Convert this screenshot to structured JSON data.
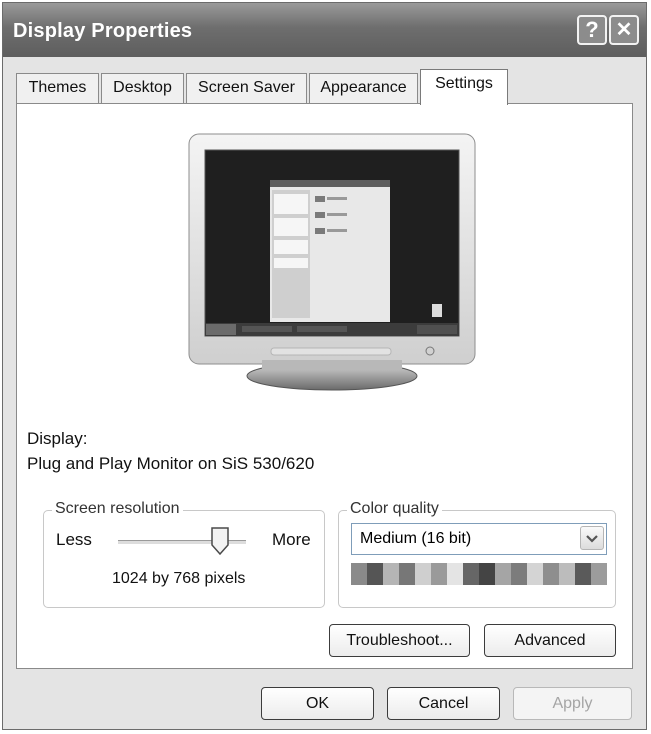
{
  "window": {
    "title": "Display Properties",
    "help_glyph": "?",
    "close_glyph": "✕"
  },
  "tabs": [
    {
      "label": "Themes"
    },
    {
      "label": "Desktop"
    },
    {
      "label": "Screen Saver"
    },
    {
      "label": "Appearance"
    },
    {
      "label": "Settings",
      "active": true
    }
  ],
  "display": {
    "label": "Display:",
    "device": "Plug and Play Monitor on SiS 530/620"
  },
  "resolution": {
    "group_label": "Screen resolution",
    "less": "Less",
    "more": "More",
    "value_text": "1024 by 768 pixels",
    "slider_position": 0.8
  },
  "color_quality": {
    "group_label": "Color quality",
    "selected": "Medium (16 bit)"
  },
  "buttons": {
    "troubleshoot": "Troubleshoot...",
    "advanced": "Advanced",
    "ok": "OK",
    "cancel": "Cancel",
    "apply": "Apply"
  },
  "icons": [
    "help-icon",
    "close-icon",
    "monitor-icon",
    "slider-thumb",
    "dropdown-arrow-icon",
    "color-swatch-bar"
  ],
  "colors": {
    "title_bar": "#6e6e6e",
    "desktop_preview": "#1f1f1f",
    "window_face": "#e4e4e4"
  }
}
